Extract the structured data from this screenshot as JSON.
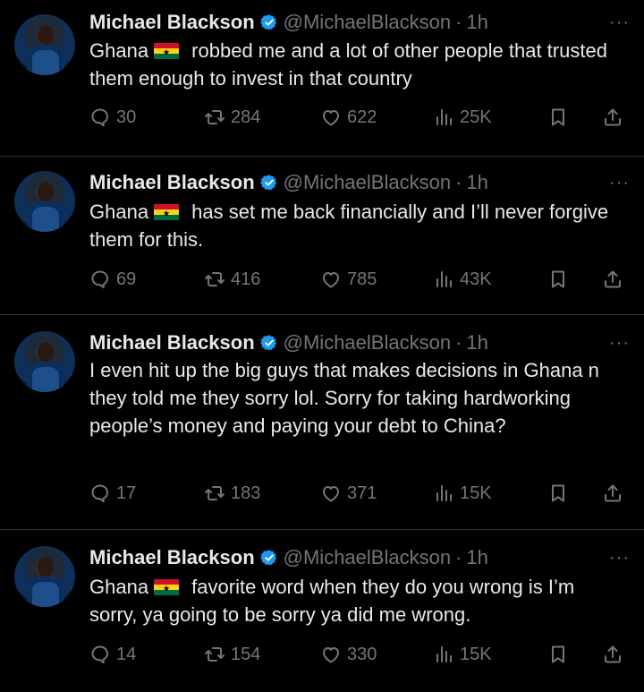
{
  "tweets": [
    {
      "name": "Michael Blackson",
      "handle": "@MichaelBlackson",
      "dot": "·",
      "time": "1h",
      "more": "···",
      "before_flag": "Ghana",
      "after_flag": " robbed me and a lot of other people that trusted them enough to invest in that country",
      "replies": "30",
      "reposts": "284",
      "likes": "622",
      "views": "25K"
    },
    {
      "name": "Michael Blackson",
      "handle": "@MichaelBlackson",
      "dot": "·",
      "time": "1h",
      "more": "···",
      "before_flag": "Ghana",
      "after_flag": " has set me back financially and I’ll never forgive them for this.",
      "replies": "69",
      "reposts": "416",
      "likes": "785",
      "views": "43K"
    },
    {
      "name": "Michael Blackson",
      "handle": "@MichaelBlackson",
      "dot": "·",
      "time": "1h",
      "more": "···",
      "before_flag": "",
      "after_flag": "I even hit up the big guys that makes decisions in Ghana n they told me they sorry lol. Sorry for taking hardworking people’s money and paying your debt to China?",
      "replies": "17",
      "reposts": "183",
      "likes": "371",
      "views": "15K"
    },
    {
      "name": "Michael Blackson",
      "handle": "@MichaelBlackson",
      "dot": "·",
      "time": "1h",
      "more": "···",
      "before_flag": "Ghana",
      "after_flag": " favorite word when they do you wrong is I’m sorry, ya going to be sorry ya did me wrong.",
      "replies": "14",
      "reposts": "154",
      "likes": "330",
      "views": "15K"
    }
  ],
  "icons": {
    "verified": "verified-badge-icon",
    "flag": "ghana-flag-icon",
    "reply": "reply-icon",
    "repost": "repost-icon",
    "like": "heart-icon",
    "views": "views-icon",
    "bookmark": "bookmark-icon",
    "share": "share-icon"
  },
  "colors": {
    "background": "#000000",
    "text": "#e7e9ea",
    "muted": "#71767b",
    "verified": "#1d9bf0",
    "divider": "#2f3336"
  }
}
